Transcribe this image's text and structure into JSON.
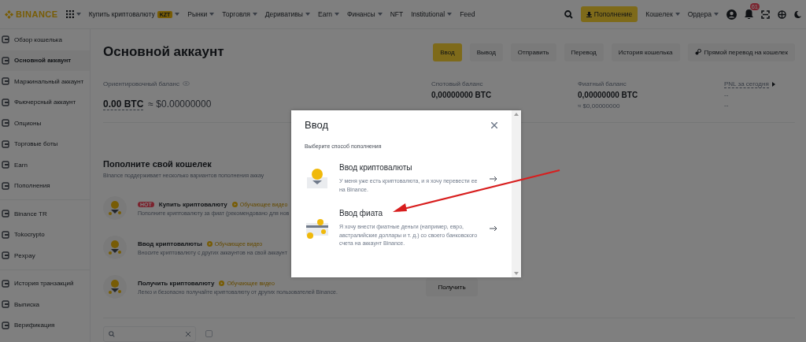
{
  "header": {
    "logo": "BINANCE",
    "nav": [
      {
        "label": "Купить криптовалюту",
        "badge": "KZT",
        "caret": true
      },
      {
        "label": "Рынки",
        "caret": true
      },
      {
        "label": "Торговля",
        "caret": true
      },
      {
        "label": "Деривативы",
        "caret": true
      },
      {
        "label": "Earn",
        "caret": true
      },
      {
        "label": "Финансы",
        "caret": true
      },
      {
        "label": "NFT",
        "caret": false
      },
      {
        "label": "Institutional",
        "caret": true
      },
      {
        "label": "Feed",
        "caret": false
      }
    ],
    "deposit_button": "Пополнение",
    "menus": [
      {
        "label": "Кошелек"
      },
      {
        "label": "Ордера"
      }
    ],
    "notification_count": "61"
  },
  "sidebar": {
    "groups": [
      [
        {
          "label": "Обзор кошелька",
          "selected": false
        },
        {
          "label": "Основной аккаунт",
          "selected": true
        },
        {
          "label": "Маржинальный аккаунт",
          "selected": false
        },
        {
          "label": "Фьючерсный аккаунт",
          "selected": false
        },
        {
          "label": "Опционы",
          "selected": false
        },
        {
          "label": "Торговые боты",
          "selected": false
        },
        {
          "label": "Earn",
          "selected": false
        },
        {
          "label": "Пополнения",
          "selected": false
        }
      ],
      [
        {
          "label": "Binance TR",
          "selected": false
        },
        {
          "label": "Tokocrypto",
          "selected": false
        },
        {
          "label": "Pexpay",
          "selected": false
        }
      ],
      [
        {
          "label": "История транзакций",
          "selected": false
        },
        {
          "label": "Выписка",
          "selected": false
        },
        {
          "label": "Верификация",
          "selected": false
        }
      ]
    ]
  },
  "main": {
    "title": "Основной аккаунт",
    "actions": [
      {
        "label": "Ввод",
        "kind": "primary"
      },
      {
        "label": "Вывод",
        "kind": "secondary"
      },
      {
        "label": "Отправить",
        "kind": "secondary"
      },
      {
        "label": "Перевод",
        "kind": "secondary"
      },
      {
        "label": "История кошелька",
        "kind": "secondary"
      },
      {
        "label": "Прямой перевод на кошелек",
        "kind": "secondary"
      }
    ],
    "estimated": {
      "label": "Ориентировочный баланс",
      "btc": "0.00 BTC",
      "usd": "≈ $0.00000000"
    },
    "balances": [
      {
        "label": "Спотовый баланс",
        "value": "0,00000000 BTC"
      },
      {
        "label": "Фиатный баланс",
        "value": "0,00000000 BTC",
        "sub": "≈ $0,00000000"
      }
    ],
    "pnl": {
      "label": "PNL за сегодня",
      "value": "--",
      "sub": "--"
    },
    "fund": {
      "title": "Пополните свой кошелек",
      "description": "Binance поддерживает несколько вариантов пополнения аккау",
      "options": [
        {
          "title": "Купить криптовалюту",
          "hot": "HOT",
          "video": "Обучающее видео",
          "description": "Пополните криптовалюту за фиат (рекомендовано для нов"
        },
        {
          "title": "Ввод криптовалюты",
          "video": "Обучающее видео",
          "description": "Вносите криптовалюту с других аккаунтов на свой аккаунт"
        },
        {
          "title": "Получить криптовалюту",
          "video": "Обучающее видео",
          "description": "Легко и безопасно получайте криптовалюту от других пользователей Binance.",
          "button": "Получить"
        }
      ]
    },
    "filter": {
      "checked": false
    }
  },
  "modal": {
    "title": "Ввод",
    "subtitle": "Выберите способ пополнения",
    "options": [
      {
        "kind": "crypto",
        "title": "Ввод криптовалюты",
        "description": "У меня уже есть криптовалюта, и я хочу перевести ее на Binance."
      },
      {
        "kind": "fiat",
        "title": "Ввод фиата",
        "description": "Я хочу внести фиатные деньги (например, евро, австралийские доллары и т. д.) со своего банковского счета на аккаунт Binance."
      }
    ]
  }
}
